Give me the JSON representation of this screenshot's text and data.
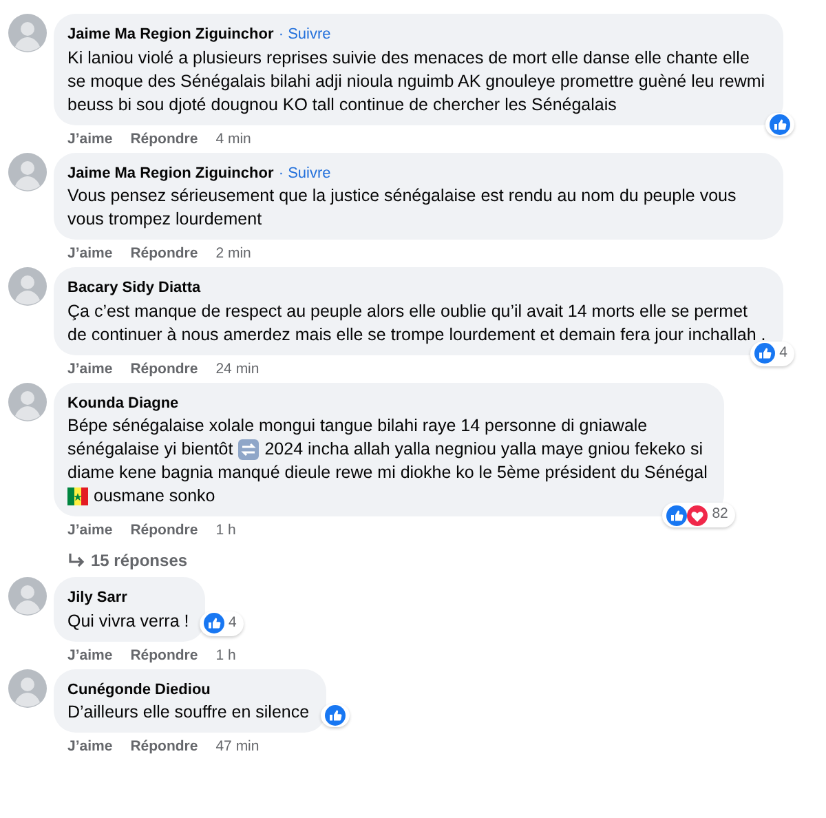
{
  "comments": [
    {
      "author": "Jaime Ma Region Ziguinchor",
      "follow": "· Suivre",
      "text": "Ki laniou violé a plusieurs reprises suivie des menaces de mort elle danse elle chante elle se moque des Sénégalais bilahi adji nioula nguimb AK gnouleye promettre guèné leu rewmi beuss bi sou djoté dougnou KO tall continue de chercher les Sénégalais",
      "reactions": [
        {
          "kind": "like"
        }
      ],
      "actions": [
        "J’aime",
        "Répondre"
      ],
      "time": "4 min"
    },
    {
      "author": "Jaime Ma Region Ziguinchor",
      "follow": "· Suivre",
      "text": "Vous pensez sérieusement que la justice sénégalaise est rendu au nom du peuple vous vous trompez lourdement",
      "actions": [
        "J’aime",
        "Répondre"
      ],
      "time": "2 min"
    },
    {
      "author": "Bacary Sidy Diatta",
      "text": "Ça c’est manque de respect au peuple alors elle oublie qu’il avait 14 morts elle se permet de continuer à nous amerdez mais elle se trompe lourdement et demain fera jour inchallah .",
      "reactions": [
        {
          "kind": "like"
        }
      ],
      "reaction_count": "4",
      "actions": [
        "J’aime",
        "Répondre"
      ],
      "time": "24 min"
    },
    {
      "author": "Kounda Diagne",
      "lines": [
        [
          {
            "kind": "text",
            "text": "Bépe sénégalaise xolale mongui tangue bilahi raye 14 personne di gniawale"
          }
        ],
        [
          {
            "kind": "text",
            "text": "sénégalaise yi bientôt"
          },
          {
            "kind": "arrow"
          },
          {
            "kind": "text",
            "text": "2024 incha allah yalla negniou yalla maye gniou fekeko si"
          }
        ],
        [
          {
            "kind": "text",
            "text": "diame kene bagnia manqué dieule rewe mi diokhe ko le 5ème président du Sénégal"
          }
        ],
        [
          {
            "kind": "flag"
          },
          {
            "kind": "text",
            "text": "ousmane sonko"
          }
        ]
      ],
      "reactions": [
        {
          "kind": "like"
        },
        {
          "kind": "love"
        }
      ],
      "reaction_count": "82",
      "actions": [
        "J’aime",
        "Répondre"
      ],
      "time": "1 h",
      "replies": "15 réponses"
    },
    {
      "author": "Jily Sarr",
      "text": "Qui vivra verra !",
      "reactions": [
        {
          "kind": "like"
        }
      ],
      "reaction_count": "4",
      "actions": [
        "J’aime",
        "Répondre"
      ],
      "time": "1 h"
    },
    {
      "author": "Cunégonde Diediou",
      "text": "D’ailleurs elle souffre en silence",
      "reactions": [
        {
          "kind": "like"
        }
      ],
      "actions": [
        "J’aime",
        "Répondre"
      ],
      "time": "47 min"
    }
  ]
}
